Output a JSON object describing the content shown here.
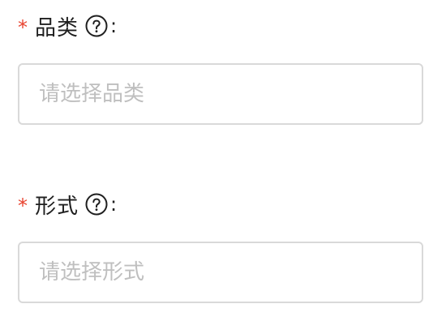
{
  "form": {
    "fields": [
      {
        "required_mark": "*",
        "label": "品类",
        "help_icon": "question-circle-icon",
        "colon": ":",
        "placeholder": "请选择品类",
        "value": ""
      },
      {
        "required_mark": "*",
        "label": "形式",
        "help_icon": "question-circle-icon",
        "colon": ":",
        "placeholder": "请选择形式",
        "value": ""
      }
    ]
  },
  "colors": {
    "required": "#e8432f",
    "border": "#d9d9d9",
    "placeholder": "#bfbfbf",
    "text": "#1f1f1f"
  }
}
